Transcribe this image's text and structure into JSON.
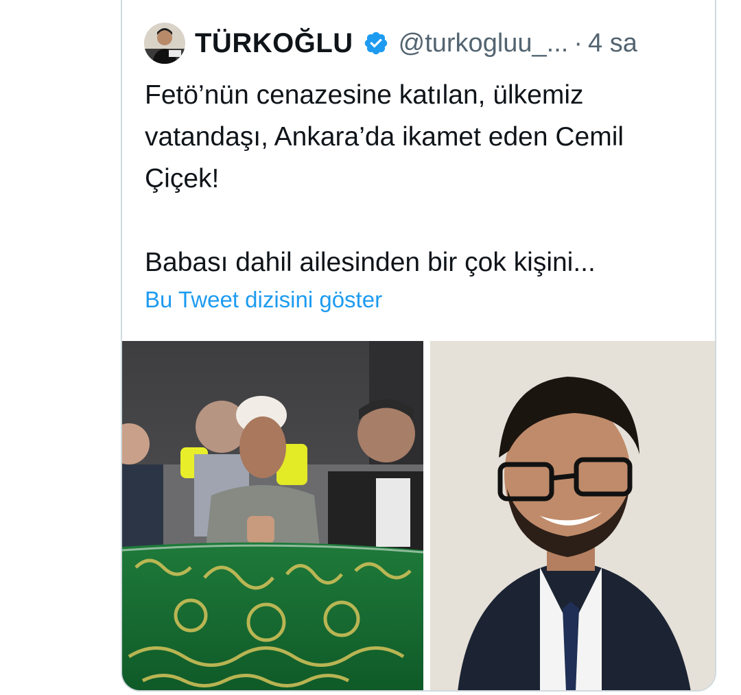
{
  "tweet": {
    "author": {
      "display_name": "TÜRKOĞLU",
      "handle": "@turkogluu_...",
      "verified": true,
      "avatar_icon": "user-avatar"
    },
    "separator": "·",
    "time": "4 sa",
    "text": "Fetö’nün cenazesine katılan, ülkemiz vatandaşı, Ankara’da ikamet eden Cemil Çiçek!\n\nBabası dahil ailesinden bir çok kişini...",
    "show_thread_label": "Bu Tweet dizisini göster",
    "media": [
      {
        "name": "funeral-photo"
      },
      {
        "name": "portrait-photo"
      }
    ]
  },
  "colors": {
    "text": "#0f1419",
    "secondary": "#536471",
    "link": "#1d9bf0",
    "border": "#cfd9de",
    "verified": "#1d9bf0"
  }
}
